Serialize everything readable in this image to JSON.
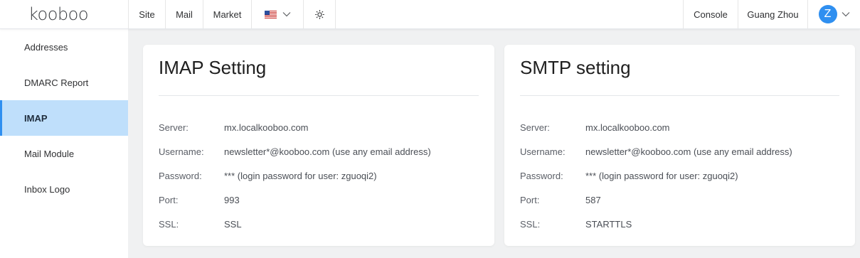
{
  "brand": {
    "logo_text": "kooboo"
  },
  "header": {
    "nav": [
      "Site",
      "Mail",
      "Market"
    ],
    "lang_icon": "us-flag-icon",
    "theme_icon": "sun-icon",
    "console": "Console",
    "user": "Guang Zhou",
    "avatar_letter": "Z"
  },
  "sidebar": {
    "items": [
      {
        "label": "Addresses",
        "active": false
      },
      {
        "label": "DMARC Report",
        "active": false
      },
      {
        "label": "IMAP",
        "active": true
      },
      {
        "label": "Mail Module",
        "active": false
      },
      {
        "label": "Inbox Logo",
        "active": false
      }
    ]
  },
  "imap": {
    "title": "IMAP Setting",
    "rows": [
      {
        "label": "Server:",
        "value": "mx.localkooboo.com"
      },
      {
        "label": "Username:",
        "value": "newsletter*@kooboo.com (use any email address)"
      },
      {
        "label": "Password:",
        "value": "*** (login password for user: zguoqi2)"
      },
      {
        "label": "Port:",
        "value": "993"
      },
      {
        "label": "SSL:",
        "value": "SSL"
      }
    ]
  },
  "smtp": {
    "title": "SMTP setting",
    "rows": [
      {
        "label": "Server:",
        "value": "mx.localkooboo.com"
      },
      {
        "label": "Username:",
        "value": "newsletter*@kooboo.com (use any email address)"
      },
      {
        "label": "Password:",
        "value": "*** (login password for user: zguoqi2)"
      },
      {
        "label": "Port:",
        "value": "587"
      },
      {
        "label": "SSL:",
        "value": "STARTTLS"
      }
    ]
  },
  "colors": {
    "accent": "#2f8ff0",
    "active_bg": "#bfdffb",
    "page_bg": "#f0f1f2"
  }
}
